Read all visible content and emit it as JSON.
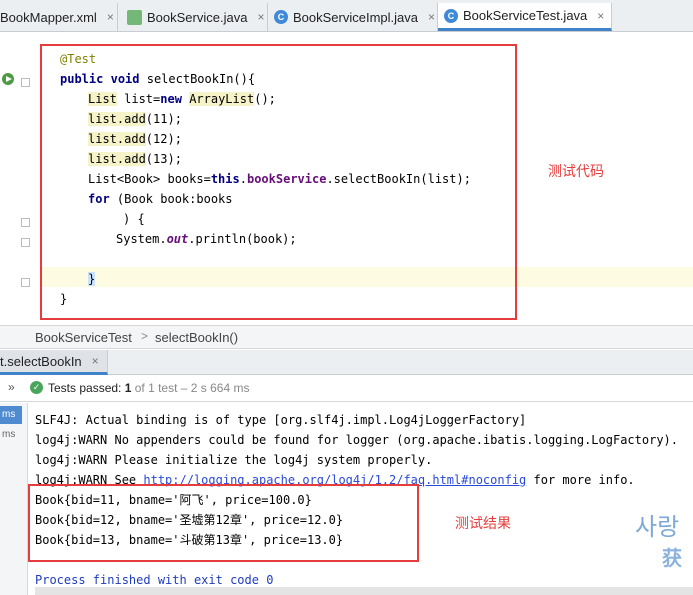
{
  "tabs": [
    {
      "label": "BookMapper.xml",
      "icon": "xml-file-icon"
    },
    {
      "label": "BookService.java",
      "icon": "interface-icon"
    },
    {
      "label": "BookServiceImpl.java",
      "icon": "class-icon"
    },
    {
      "label": "BookServiceTest.java",
      "icon": "class-icon",
      "active": true
    }
  ],
  "tab_close_glyph": "×",
  "class_icon_letter": "C",
  "code": {
    "annotation": "@Test",
    "signature_kw1": "public",
    "signature_kw2": "void",
    "signature_rest": " selectBookIn(){",
    "line_list_decl_type": "List",
    "line_list_decl_mid": " list=",
    "line_list_decl_kw": "new",
    "line_list_decl_space": " ",
    "line_list_decl_class": "ArrayList",
    "line_list_decl_end": "();",
    "add_target": "list.add",
    "add1_args": "(11);",
    "add2_args": "(12);",
    "add3_args": "(13);",
    "books_line_start": "List<Book> books=",
    "books_line_this": "this",
    "books_line_dot": ".",
    "books_line_field": "bookService",
    "books_line_end": ".selectBookIn(list);",
    "for_kw": "for",
    "for_rest": " (Book book:books",
    "for_close": ") {",
    "println_start": "System.",
    "println_out": "out",
    "println_end": ".println(book);",
    "close_brace": "}",
    "method_close": "}"
  },
  "annotations": {
    "code_label": "测试代码",
    "result_label": "测试结果"
  },
  "breadcrumb": {
    "class_name": "BookServiceTest",
    "separator": ">",
    "method_name": "selectBookIn()"
  },
  "run_tab": {
    "label": "t.selectBookIn",
    "close": "×"
  },
  "status": {
    "arrows": "»",
    "check_glyph": "✓",
    "prefix": "Tests passed: ",
    "passed": "1",
    "rest": " of 1 test – 2 s 664 ms"
  },
  "console": {
    "gutter_ms": [
      "ms",
      "ms"
    ],
    "lines": [
      "SLF4J: Actual binding is of type [org.slf4j.impl.Log4jLoggerFactory]",
      "log4j:WARN No appenders could be found for logger (org.apache.ibatis.logging.LogFactory).",
      "log4j:WARN Please initialize the log4j system properly."
    ],
    "link_prefix": "log4j:WARN See ",
    "link_url": "http://logging.apache.org/log4j/1.2/faq.html#noconfig",
    "link_suffix": " for more info.",
    "results": [
      "Book{bid=11, bname='阿飞', price=100.0}",
      "Book{bid=12, bname='圣墟第12章', price=12.0}",
      "Book{bid=13, bname='斗破第13章', price=13.0}"
    ],
    "exit_line": "Process finished with exit code 0"
  },
  "watermark": {
    "line1": "사랑",
    "line2": "获"
  },
  "colors": {
    "accent": "#4083c9",
    "highlight_box": "#e53d3d",
    "pass_green": "#49a55b",
    "watermark": "#6f9fd4"
  }
}
